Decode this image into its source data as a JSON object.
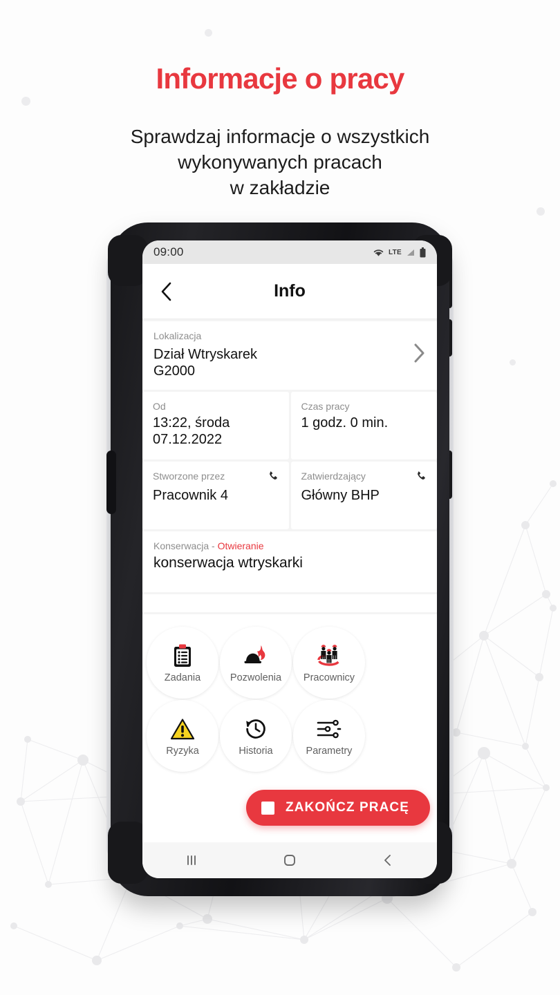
{
  "promo": {
    "headline": "Informacje o pracy",
    "subline_1": "Sprawdzaj informacje o wszystkich",
    "subline_2": "wykonywanych pracach",
    "subline_3": "w zakładzie",
    "accent_color": "#e8383f"
  },
  "phone": {
    "statusbar": {
      "time": "09:00",
      "network_label": "LTE",
      "icons": [
        "wifi-icon",
        "signal-icon",
        "battery-icon"
      ]
    },
    "appbar": {
      "back_icon": "chevron-left-icon",
      "title": "Info"
    },
    "location": {
      "label": "Lokalizacja",
      "value_line_1": "Dział Wtryskarek",
      "value_line_2": "G2000",
      "chevron_icon": "chevron-right-icon"
    },
    "info_cells": [
      {
        "label": "Od",
        "value_line_1": "13:22, środa",
        "value_line_2": "07.12.2022",
        "icon": ""
      },
      {
        "label": "Czas pracy",
        "value_line_1": "1 godz. 0 min.",
        "value_line_2": "",
        "icon": ""
      },
      {
        "label": "Stworzone przez",
        "value_line_1": "Pracownik  4",
        "value_line_2": "",
        "icon": "phone-icon"
      },
      {
        "label": "Zatwierdzający",
        "value_line_1": "Główny BHP",
        "value_line_2": "",
        "icon": "phone-icon"
      }
    ],
    "description": {
      "label_main": "Konserwacja - ",
      "label_accent": "Otwieranie",
      "value": "konserwacja wtryskarki"
    },
    "actions": [
      {
        "label": "Zadania",
        "icon": "clipboard-icon"
      },
      {
        "label": "Pozwolenia",
        "icon": "helmet-fire-icon"
      },
      {
        "label": "Pracownicy",
        "icon": "workers-icon"
      },
      {
        "label": "Ryzyka",
        "icon": "warning-triangle-icon"
      },
      {
        "label": "Historia",
        "icon": "history-clock-icon"
      },
      {
        "label": "Parametry",
        "icon": "sliders-icon"
      }
    ],
    "cta": {
      "label": "ZAKOŃCZ PRACĘ",
      "icon": "stop-square-icon",
      "color": "#e8383f"
    },
    "navbar": {
      "recents_icon": "recents-icon",
      "home_icon": "home-icon",
      "back_icon": "nav-back-icon"
    }
  }
}
